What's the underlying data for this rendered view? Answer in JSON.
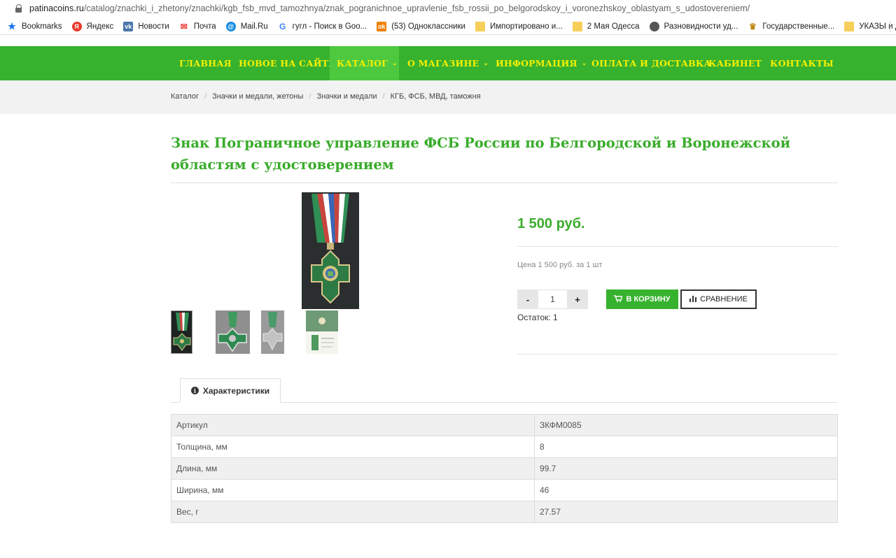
{
  "browser": {
    "url_host": "patinacoins.ru",
    "url_path": "/catalog/znachki_i_zhetony/znachki/kgb_fsb_mvd_tamozhnya/znak_pogranichnoe_upravlenie_fsb_rossii_po_belgorodskoy_i_voronezhskoy_oblastyam_s_udostovereniem/",
    "bookmarks": [
      {
        "label": "Bookmarks",
        "icon": "star-icon"
      },
      {
        "label": "Яндекс",
        "icon": "yandex-icon"
      },
      {
        "label": "Новости",
        "icon": "vk-icon"
      },
      {
        "label": "Почта",
        "icon": "mail-icon"
      },
      {
        "label": "Mail.Ru",
        "icon": "mailru-icon"
      },
      {
        "label": "гугл - Поиск в Goo...",
        "icon": "google-icon"
      },
      {
        "label": "(53) Одноклассники",
        "icon": "ok-icon"
      },
      {
        "label": "Импортировано и...",
        "icon": "folder-icon"
      },
      {
        "label": "2 Мая Одесса",
        "icon": "folder-icon"
      },
      {
        "label": "Разновидности уд...",
        "icon": "globe-icon"
      },
      {
        "label": "Государственные...",
        "icon": "emblem-icon"
      },
      {
        "label": "УКАЗЫ и ДОКИ РФ",
        "icon": "folder-icon"
      }
    ]
  },
  "nav": {
    "items": [
      {
        "label": "ГЛАВНАЯ"
      },
      {
        "label": "НОВОЕ НА САЙТЕ"
      },
      {
        "label": "КАТАЛОГ"
      },
      {
        "label": "О МАГАЗИНЕ"
      },
      {
        "label": "ИНФОРМАЦИЯ"
      },
      {
        "label": "ОПЛАТА И ДОСТАВКА"
      },
      {
        "label": "КАБИНЕТ"
      },
      {
        "label": "КОНТАКТЫ"
      }
    ],
    "chevron": "⌄"
  },
  "breadcrumbs": [
    "Каталог",
    "Значки и медали, жетоны",
    "Значки и медали",
    "КГБ, ФСБ, МВД, таможня"
  ],
  "product": {
    "title": "Знак Пограничное управление ФСБ России по Белгородской и Воронежской областям с удостоверением",
    "price": "1 500 руб.",
    "unit_price": "Цена 1 500 руб. за 1 шт",
    "qty_minus": "-",
    "qty_value": "1",
    "qty_plus": "+",
    "cart_label": "В КОРЗИНУ",
    "compare_label": "СРАВНЕНИЕ",
    "stock": "Остаток: 1"
  },
  "tabs": {
    "specs_label": "Характеристики"
  },
  "specs": [
    {
      "key": "Артикул",
      "value": "ЗКФМ0085"
    },
    {
      "key": "Толщина, мм",
      "value": "8"
    },
    {
      "key": "Длина, мм",
      "value": "99.7"
    },
    {
      "key": "Ширина, мм",
      "value": "46"
    },
    {
      "key": "Вес, г",
      "value": "27.57"
    }
  ],
  "colors": {
    "brand_green": "#37b22e",
    "nav_text": "#f6f000",
    "title_green": "#3aac2c"
  }
}
